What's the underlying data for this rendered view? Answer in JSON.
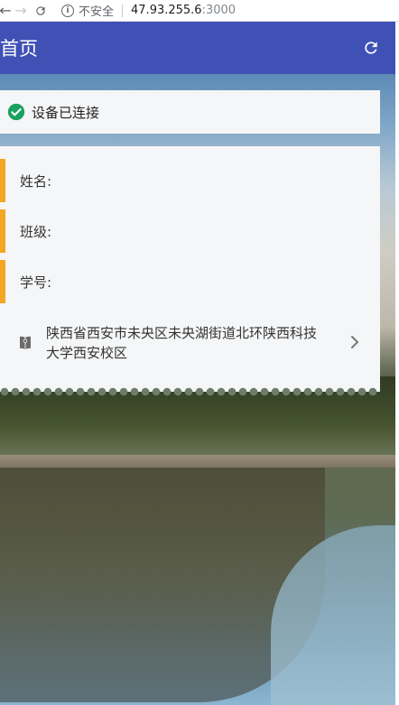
{
  "browser": {
    "security_label": "不安全",
    "url_host": "47.93.255.6",
    "url_port": ":3000"
  },
  "header": {
    "title": "首页",
    "refresh_icon": "refresh-icon"
  },
  "status": {
    "text": "设备已连接",
    "icon": "check-circle-icon",
    "color": "#1aa260"
  },
  "info": {
    "name_label": "姓名:",
    "class_label": "班级:",
    "student_id_label": "学号:",
    "address": "陕西省西安市未央区未央湖街道北环陕西科技大学西安校区",
    "address_icon": "book-icon",
    "accent_color": "#f5a623"
  },
  "colors": {
    "header_bg": "#3f51b5"
  }
}
